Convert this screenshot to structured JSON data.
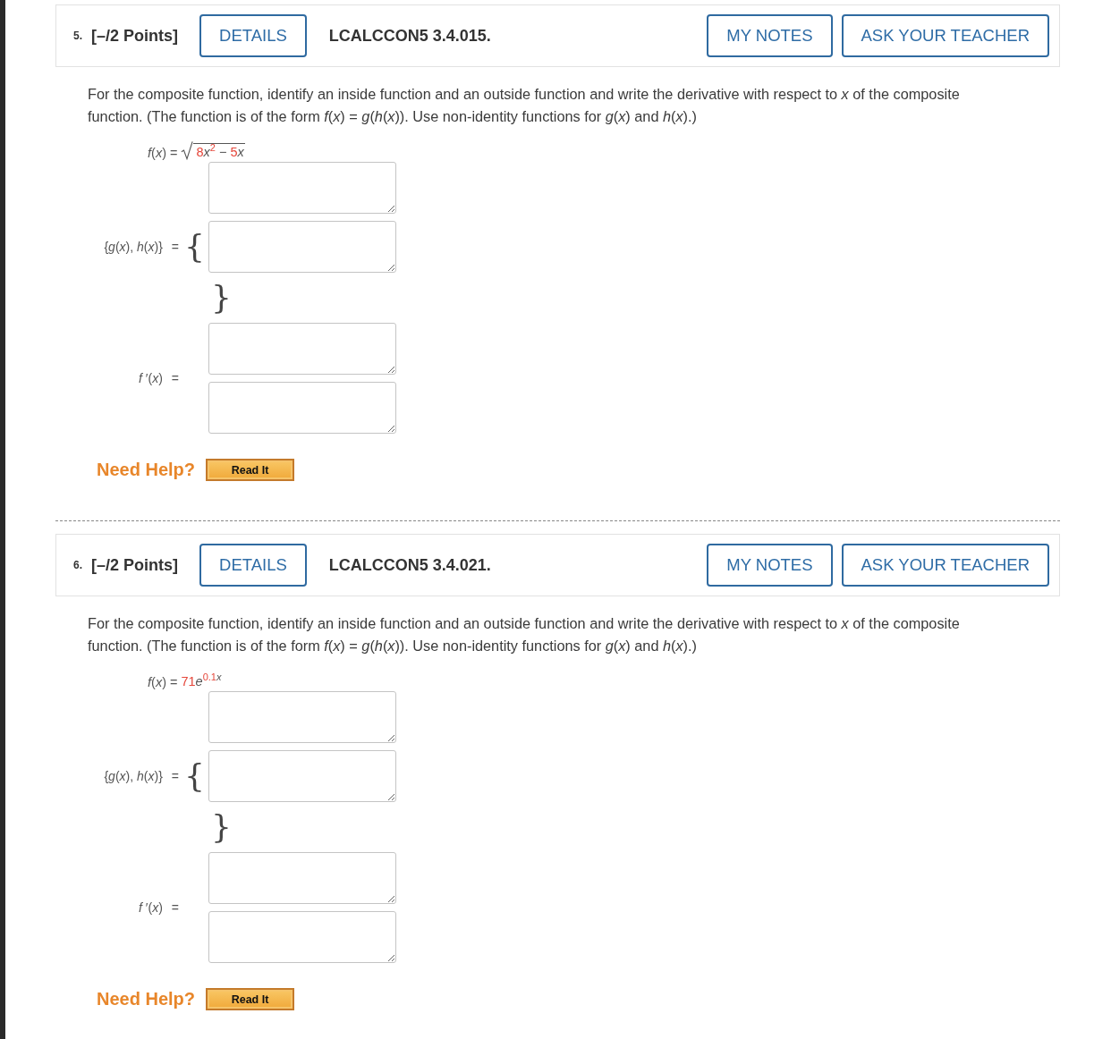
{
  "questions": [
    {
      "number": "5.",
      "points": "[–/2 Points]",
      "details": "DETAILS",
      "code": "LCALCCON5 3.4.015.",
      "notes": "MY NOTES",
      "ask": "ASK YOUR TEACHER",
      "prompt": "For the composite function, identify an inside function and an outside function and write the derivative with respect to *x* of the composite function. (The function is of the form  *f*(*x*) = *g*(*h*(*x*)).  Use non-identity functions for *g*(*x*) and *h*(*x*).)",
      "function": {
        "lhs": "*f*(*x*) =",
        "kind": "sqrt",
        "tokens": [
          {
            "text": "8",
            "kind": "number"
          },
          {
            "text": "x",
            "kind": "variable"
          },
          {
            "text": "2",
            "kind": "raised-number"
          },
          {
            "text": " − ",
            "kind": "operator"
          },
          {
            "text": "5",
            "kind": "number"
          },
          {
            "text": "x",
            "kind": "variable"
          }
        ]
      },
      "pair": {
        "label": "{*g*(*x*), *h*(*x*)}",
        "equals": "=",
        "open_brace": "{",
        "close_brace": "}"
      },
      "derivative": {
        "label": "*f* ′(*x*)",
        "equals": "="
      },
      "help": {
        "label": "Need Help?",
        "button": "Read It"
      }
    },
    {
      "number": "6.",
      "points": "[–/2 Points]",
      "details": "DETAILS",
      "code": "LCALCCON5 3.4.021.",
      "notes": "MY NOTES",
      "ask": "ASK YOUR TEACHER",
      "prompt": "For the composite function, identify an inside function and an outside function and write the derivative with respect to *x* of the composite function. (The function is of the form  *f*(*x*) = *g*(*h*(*x*)).  Use non-identity functions for *g*(*x*) and *h*(*x*).)",
      "function": {
        "lhs": "*f*(*x*) =",
        "kind": "plain",
        "tokens": [
          {
            "text": "71",
            "kind": "number"
          },
          {
            "text": "e",
            "kind": "variable"
          },
          {
            "text": "0.1",
            "kind": "raised-number"
          },
          {
            "text": "x",
            "kind": "raised-variable"
          }
        ]
      },
      "pair": {
        "label": "{*g*(*x*), *h*(*x*)}",
        "equals": "=",
        "open_brace": "{",
        "close_brace": "}"
      },
      "derivative": {
        "label": "*f* ′(*x*)",
        "equals": "="
      },
      "help": {
        "label": "Need Help?",
        "button": "Read It"
      }
    }
  ]
}
